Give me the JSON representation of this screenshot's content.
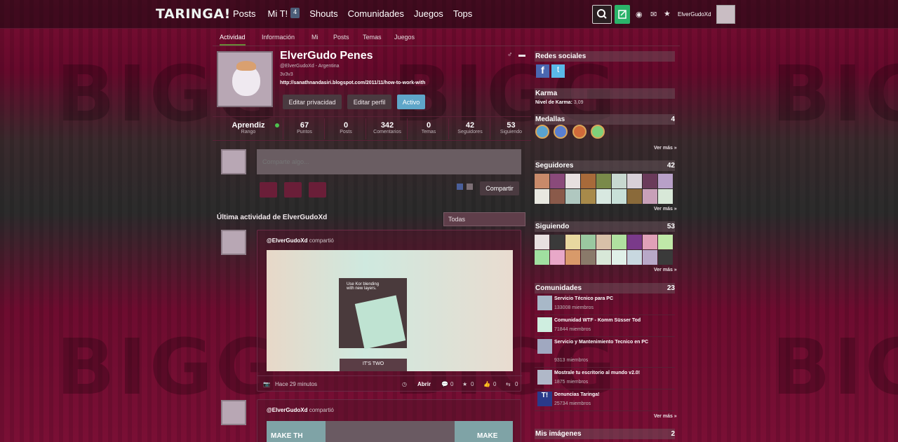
{
  "topbar": {
    "logo": "TARINGA!",
    "nav": [
      "Posts",
      "Mi T!",
      "Shouts",
      "Comunidades",
      "Juegos",
      "Tops"
    ],
    "mi_t_badge": "4",
    "username": "ElverGudoXd",
    "icons": [
      "search-icon",
      "new-post-icon",
      "eye-icon",
      "mail-icon",
      "star-icon"
    ]
  },
  "subnav": [
    "Actividad",
    "Información",
    "Mi",
    "Posts",
    "Temas",
    "Juegos"
  ],
  "profile": {
    "name": "ElverGudo Penes",
    "handle": "@ElverGudoXd - Argentina",
    "bio": "3v3v3",
    "link": "http://sanathnandasiri.blogspot.com/2011/11/how-to-work-with",
    "buttons": {
      "privacy": "Editar privacidad",
      "edit": "Editar perfil",
      "status": "Activo"
    },
    "stats": [
      {
        "value": "Aprendiz",
        "label": "Rango"
      },
      {
        "value": "67",
        "label": "Puntos"
      },
      {
        "value": "0",
        "label": "Posts"
      },
      {
        "value": "342",
        "label": "Comentarios"
      },
      {
        "value": "0",
        "label": "Temas"
      },
      {
        "value": "42",
        "label": "Seguidores"
      },
      {
        "value": "53",
        "label": "Siguiendo"
      }
    ]
  },
  "share": {
    "placeholder": "Comparte algo...",
    "button": "Compartir"
  },
  "activity": {
    "title": "Última actividad de ElverGudoXd",
    "filter": "Todas",
    "posts": [
      {
        "user": "@ElverGudoXd",
        "action": "compartió",
        "image_texts": {
          "caption": "Use Kor blending\nwith new layers.",
          "banner": "IT'S TWO"
        },
        "time": "Hace 29 minutos",
        "open": "Abrir",
        "comments": "0",
        "favorites": "0",
        "likes": "0",
        "reshares": "0"
      },
      {
        "user": "@ElverGudoXd",
        "action": "compartió",
        "image_texts": {
          "left": "MAKE TH",
          "right": "MAKE"
        }
      }
    ]
  },
  "sidebar": {
    "social": {
      "title": "Redes sociales"
    },
    "karma": {
      "title": "Karma",
      "label": "Nivel de Karma:",
      "value": "3,09"
    },
    "medals": {
      "title": "Medallas",
      "count": "4",
      "more": "Ver más »"
    },
    "followers": {
      "title": "Seguidores",
      "count": "42",
      "more": "Ver más »"
    },
    "following": {
      "title": "Siguiendo",
      "count": "53",
      "more": "Ver más »"
    },
    "communities": {
      "title": "Comunidades",
      "count": "23",
      "more": "Ver más »",
      "items": [
        {
          "name": "Servicio Técnico para PC",
          "members": "133008 miembros"
        },
        {
          "name": "Comunidad WTF - Komm Süsser Tod",
          "members": "71844 miembros"
        },
        {
          "name": "Servicio y Mantenimiento Tecnico en PC",
          "members": "9313 miembros"
        },
        {
          "name": "Mostrale tu escritorio al mundo v2.0!",
          "members": "1875 miembros"
        },
        {
          "name": "Denuncias Taringa!",
          "members": "25734 miembros"
        }
      ]
    },
    "images": {
      "title": "Mis imágenes",
      "count": "2"
    }
  },
  "colors": {
    "accent_green": "#2bb36a",
    "status_blue": "#5fa6c9",
    "background": "#7a0e33"
  }
}
